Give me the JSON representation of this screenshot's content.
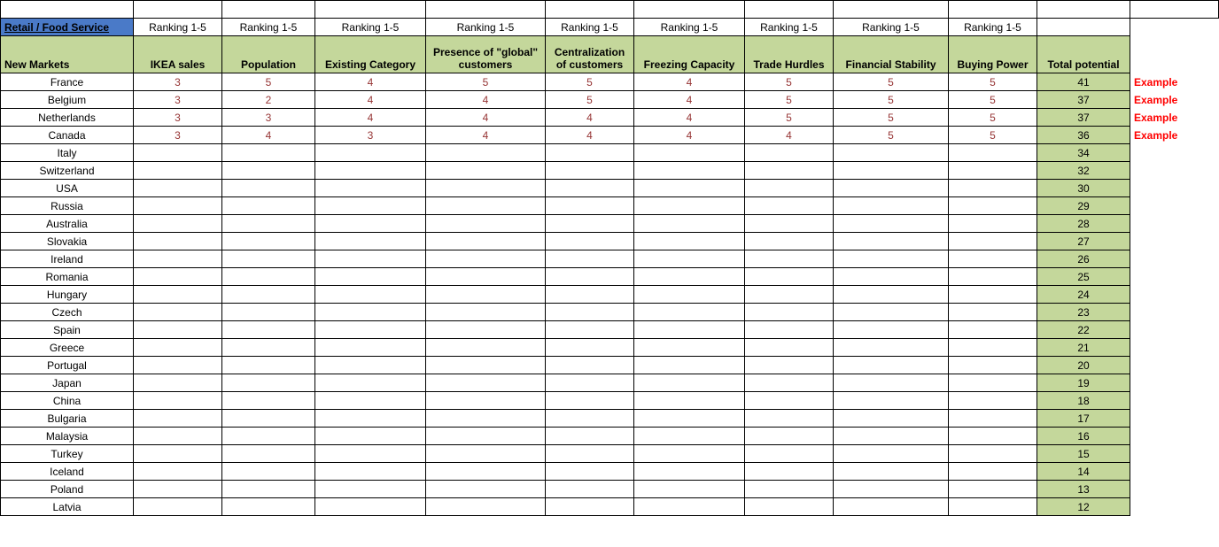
{
  "header": {
    "title": "Retail / Food Service",
    "ranking_label": "Ranking 1-5",
    "subheader": "New Markets",
    "columns": [
      "IKEA sales",
      "Population",
      "Existing Category",
      "Presence of \"global\" customers",
      "Centralization of customers",
      "Freezing Capacity",
      "Trade Hurdles",
      "Financial Stability",
      "Buying Power",
      "Total potential"
    ]
  },
  "example_label": "Example",
  "rows": [
    {
      "market": "France",
      "vals": [
        "3",
        "5",
        "4",
        "5",
        "5",
        "4",
        "5",
        "5",
        "5"
      ],
      "total": "41",
      "example": true
    },
    {
      "market": "Belgium",
      "vals": [
        "3",
        "2",
        "4",
        "4",
        "5",
        "4",
        "5",
        "5",
        "5"
      ],
      "total": "37",
      "example": true
    },
    {
      "market": "Netherlands",
      "vals": [
        "3",
        "3",
        "4",
        "4",
        "4",
        "4",
        "5",
        "5",
        "5"
      ],
      "total": "37",
      "example": true
    },
    {
      "market": "Canada",
      "vals": [
        "3",
        "4",
        "3",
        "4",
        "4",
        "4",
        "4",
        "5",
        "5"
      ],
      "total": "36",
      "example": true
    },
    {
      "market": "Italy",
      "vals": [
        "",
        "",
        "",
        "",
        "",
        "",
        "",
        "",
        ""
      ],
      "total": "34",
      "example": false
    },
    {
      "market": "Switzerland",
      "vals": [
        "",
        "",
        "",
        "",
        "",
        "",
        "",
        "",
        ""
      ],
      "total": "32",
      "example": false
    },
    {
      "market": "USA",
      "vals": [
        "",
        "",
        "",
        "",
        "",
        "",
        "",
        "",
        ""
      ],
      "total": "30",
      "example": false
    },
    {
      "market": "Russia",
      "vals": [
        "",
        "",
        "",
        "",
        "",
        "",
        "",
        "",
        ""
      ],
      "total": "29",
      "example": false
    },
    {
      "market": "Australia",
      "vals": [
        "",
        "",
        "",
        "",
        "",
        "",
        "",
        "",
        ""
      ],
      "total": "28",
      "example": false
    },
    {
      "market": "Slovakia",
      "vals": [
        "",
        "",
        "",
        "",
        "",
        "",
        "",
        "",
        ""
      ],
      "total": "27",
      "example": false
    },
    {
      "market": "Ireland",
      "vals": [
        "",
        "",
        "",
        "",
        "",
        "",
        "",
        "",
        ""
      ],
      "total": "26",
      "example": false
    },
    {
      "market": "Romania",
      "vals": [
        "",
        "",
        "",
        "",
        "",
        "",
        "",
        "",
        ""
      ],
      "total": "25",
      "example": false
    },
    {
      "market": "Hungary",
      "vals": [
        "",
        "",
        "",
        "",
        "",
        "",
        "",
        "",
        ""
      ],
      "total": "24",
      "example": false
    },
    {
      "market": "Czech",
      "vals": [
        "",
        "",
        "",
        "",
        "",
        "",
        "",
        "",
        ""
      ],
      "total": "23",
      "example": false
    },
    {
      "market": "Spain",
      "vals": [
        "",
        "",
        "",
        "",
        "",
        "",
        "",
        "",
        ""
      ],
      "total": "22",
      "example": false
    },
    {
      "market": "Greece",
      "vals": [
        "",
        "",
        "",
        "",
        "",
        "",
        "",
        "",
        ""
      ],
      "total": "21",
      "example": false
    },
    {
      "market": "Portugal",
      "vals": [
        "",
        "",
        "",
        "",
        "",
        "",
        "",
        "",
        ""
      ],
      "total": "20",
      "example": false
    },
    {
      "market": "Japan",
      "vals": [
        "",
        "",
        "",
        "",
        "",
        "",
        "",
        "",
        ""
      ],
      "total": "19",
      "example": false
    },
    {
      "market": "China",
      "vals": [
        "",
        "",
        "",
        "",
        "",
        "",
        "",
        "",
        ""
      ],
      "total": "18",
      "example": false
    },
    {
      "market": "Bulgaria",
      "vals": [
        "",
        "",
        "",
        "",
        "",
        "",
        "",
        "",
        ""
      ],
      "total": "17",
      "example": false
    },
    {
      "market": "Malaysia",
      "vals": [
        "",
        "",
        "",
        "",
        "",
        "",
        "",
        "",
        ""
      ],
      "total": "16",
      "example": false
    },
    {
      "market": "Turkey",
      "vals": [
        "",
        "",
        "",
        "",
        "",
        "",
        "",
        "",
        ""
      ],
      "total": "15",
      "example": false
    },
    {
      "market": "Iceland",
      "vals": [
        "",
        "",
        "",
        "",
        "",
        "",
        "",
        "",
        ""
      ],
      "total": "14",
      "example": false
    },
    {
      "market": "Poland",
      "vals": [
        "",
        "",
        "",
        "",
        "",
        "",
        "",
        "",
        ""
      ],
      "total": "13",
      "example": false
    },
    {
      "market": "Latvia",
      "vals": [
        "",
        "",
        "",
        "",
        "",
        "",
        "",
        "",
        ""
      ],
      "total": "12",
      "example": false
    }
  ]
}
